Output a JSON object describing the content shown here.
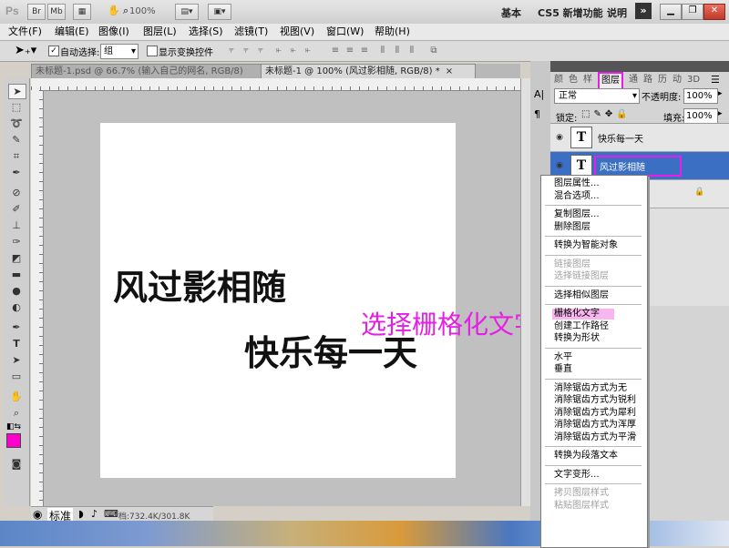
{
  "app": {
    "logo": "Ps",
    "bridge": "Br",
    "minibridge": "Mb",
    "zoom": "100%",
    "workspaces": [
      "基本",
      "CS5 新增功能",
      "说明"
    ],
    "more": "»"
  },
  "menubar": [
    "文件(F)",
    "编辑(E)",
    "图像(I)",
    "图层(L)",
    "选择(S)",
    "滤镜(T)",
    "视图(V)",
    "窗口(W)",
    "帮助(H)"
  ],
  "options": {
    "auto_select_label": "自动选择:",
    "auto_select_value": "组",
    "show_transform": "显示变换控件"
  },
  "tabs": [
    {
      "label": "未标题-1.psd @ 66.7% (输入自己的网名, RGB/8) *",
      "close": "×"
    },
    {
      "label": "未标题-1 @ 100% (风过影相随, RGB/8) *",
      "close": "×"
    }
  ],
  "canvas": {
    "text1": "风过影相随",
    "text2": "快乐每一天",
    "annotation": "选择栅格化文字"
  },
  "status": {
    "zoom": "标准",
    "doc": "档:732.4K/301.8K"
  },
  "panel": {
    "tabs": [
      "颜",
      "色",
      "样",
      "图层",
      "通",
      "路",
      "历",
      "动",
      "3D"
    ],
    "blend_mode": "正常",
    "opacity_label": "不透明度:",
    "opacity_value": "100%",
    "lock_label": "锁定:",
    "fill_label": "填充:",
    "fill_value": "100%",
    "layers": [
      {
        "name": "快乐每一天",
        "thumb": "T"
      },
      {
        "name": "风过影相随",
        "thumb": "T"
      }
    ]
  },
  "context_menu": {
    "groups": [
      [
        {
          "label": "图层属性...",
          "enabled": true
        },
        {
          "label": "混合选项...",
          "enabled": true
        }
      ],
      [
        {
          "label": "复制图层...",
          "enabled": true
        },
        {
          "label": "删除图层",
          "enabled": true
        }
      ],
      [
        {
          "label": "转换为智能对象",
          "enabled": true
        }
      ],
      [
        {
          "label": "链接图层",
          "enabled": false
        },
        {
          "label": "选择链接图层",
          "enabled": false
        }
      ],
      [
        {
          "label": "选择相似图层",
          "enabled": true
        }
      ],
      [
        {
          "label": "栅格化文字",
          "enabled": true,
          "highlight": true
        },
        {
          "label": "创建工作路径",
          "enabled": true
        },
        {
          "label": "转换为形状",
          "enabled": true
        }
      ],
      [
        {
          "label": "水平",
          "enabled": true
        },
        {
          "label": "垂直",
          "enabled": true
        }
      ],
      [
        {
          "label": "消除锯齿方式为无",
          "enabled": true
        },
        {
          "label": "消除锯齿方式为锐利",
          "enabled": true
        },
        {
          "label": "消除锯齿方式为犀利",
          "enabled": true
        },
        {
          "label": "消除锯齿方式为浑厚",
          "enabled": true
        },
        {
          "label": "消除锯齿方式为平滑",
          "enabled": true
        }
      ],
      [
        {
          "label": "转换为段落文本",
          "enabled": true
        }
      ],
      [
        {
          "label": "文字变形...",
          "enabled": true
        }
      ],
      [
        {
          "label": "拷贝图层样式",
          "enabled": false
        },
        {
          "label": "粘贴图层样式",
          "enabled": false
        }
      ]
    ]
  },
  "colors": {
    "accent_magenta": "#e61ee6",
    "selection_blue": "#3a6fc4",
    "foreground_swatch": "#ff00cc"
  }
}
